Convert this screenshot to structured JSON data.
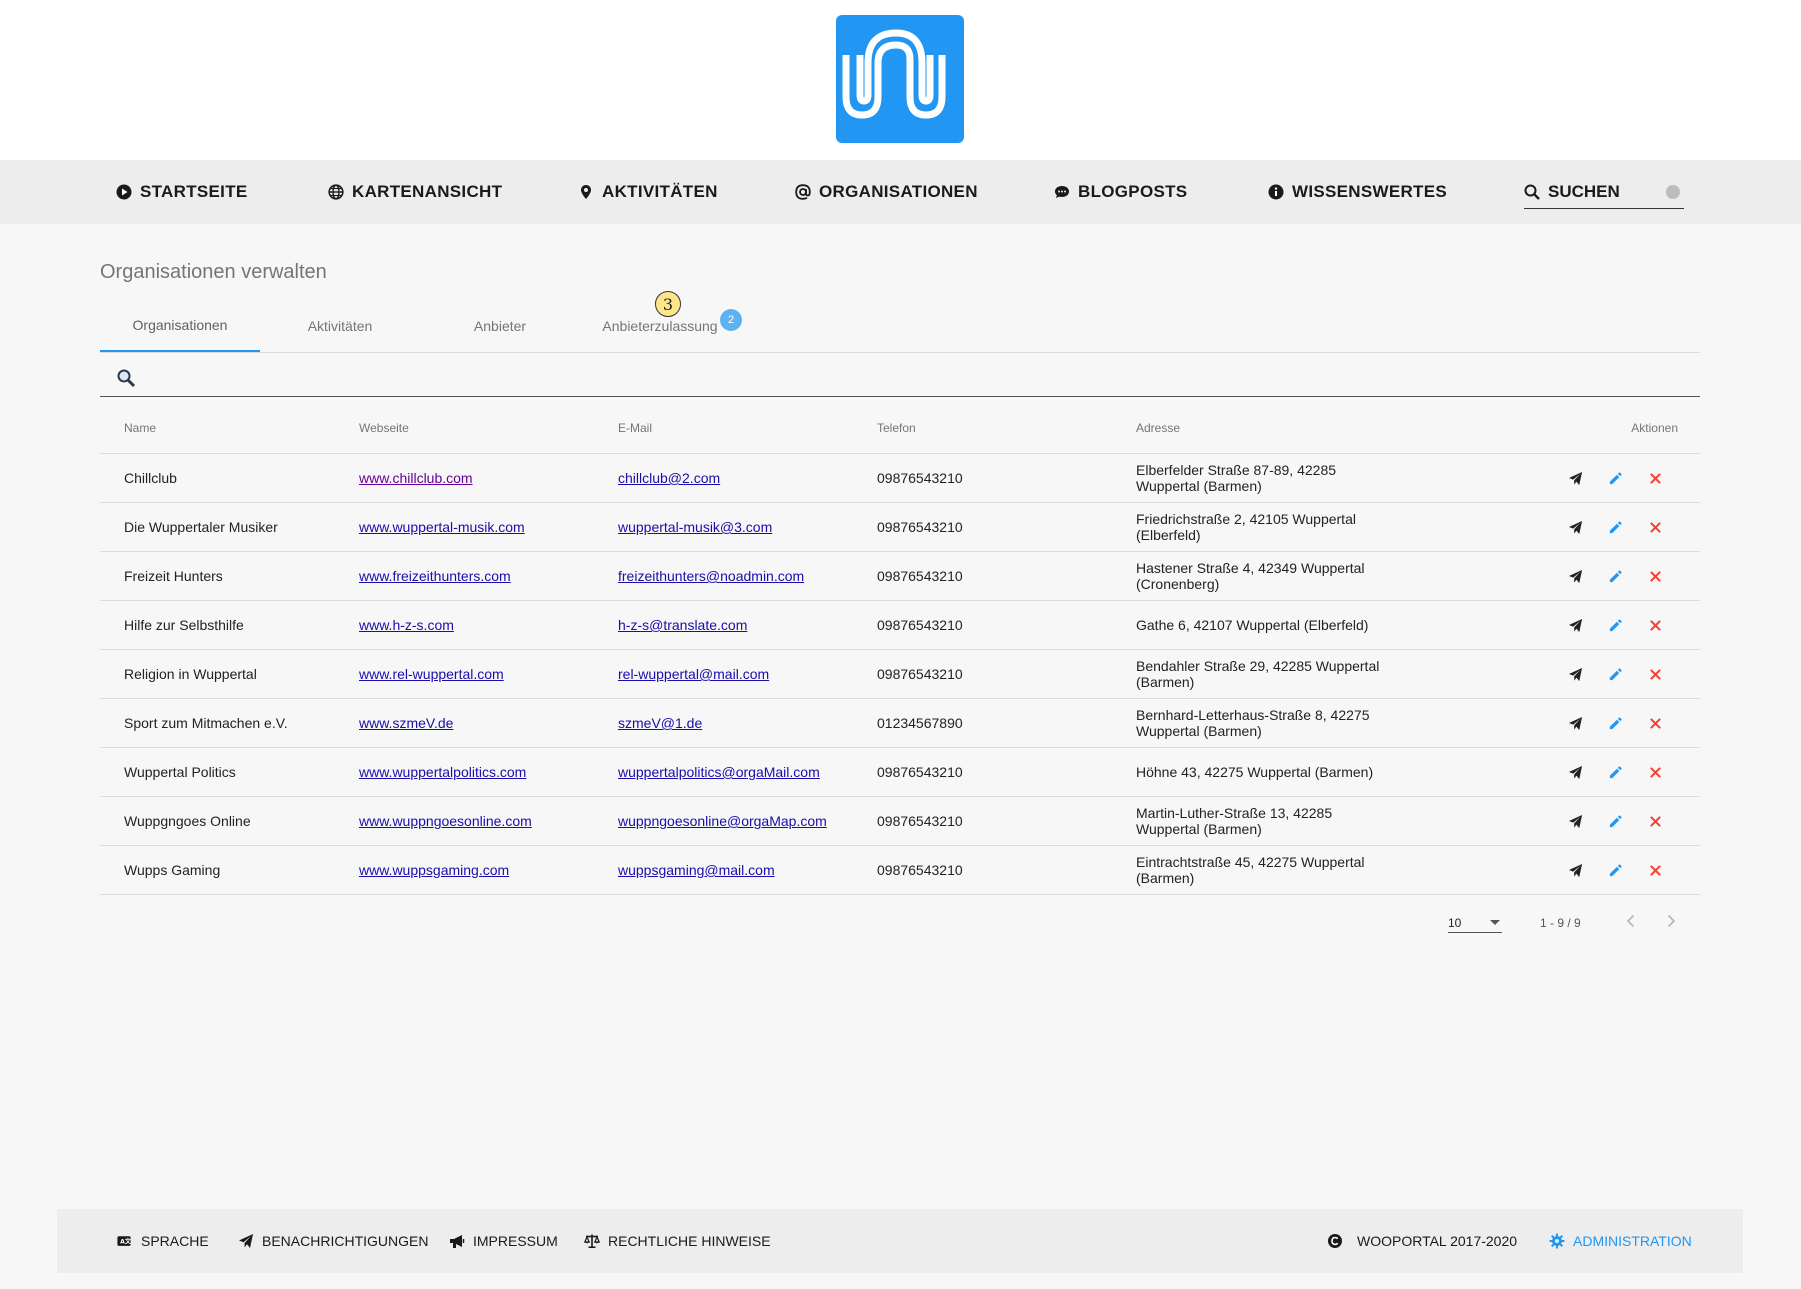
{
  "logo": {
    "icon": "wooportal-logo-icon",
    "color": "#2196f3"
  },
  "nav": {
    "items": [
      {
        "label": "STARTSEITE",
        "icon": "play-circle-icon"
      },
      {
        "label": "KARTENANSICHT",
        "icon": "globe-icon"
      },
      {
        "label": "AKTIVITÄTEN",
        "icon": "map-marker-icon"
      },
      {
        "label": "ORGANISATIONEN",
        "icon": "at-icon"
      },
      {
        "label": "BLOGPOSTS",
        "icon": "comment-dots-icon"
      },
      {
        "label": "WISSENSWERTES",
        "icon": "info-circle-icon"
      }
    ],
    "search_label": "SUCHEN"
  },
  "page": {
    "title": "Organisationen verwalten"
  },
  "tabs": [
    {
      "label": "Organisationen",
      "active": true
    },
    {
      "label": "Aktivitäten"
    },
    {
      "label": "Anbieter"
    },
    {
      "label": "Anbieterzulassung",
      "badge": "2"
    }
  ],
  "step_marker": "3",
  "search": {
    "placeholder": ""
  },
  "table": {
    "columns": [
      "Name",
      "Webseite",
      "E-Mail",
      "Telefon",
      "Adresse",
      "Aktionen"
    ],
    "rows": [
      {
        "name": "Chillclub",
        "website": "www.chillclub.com",
        "email": "chillclub@2.com",
        "phone": "09876543210",
        "address": [
          "Elberfelder Straße 87-89, 42285",
          "Wuppertal (Barmen)"
        ]
      },
      {
        "name": "Die Wuppertaler Musiker",
        "website": "www.wuppertal-musik.com",
        "email": "wuppertal-musik@3.com",
        "phone": "09876543210",
        "address": [
          "Friedrichstraße 2, 42105 Wuppertal",
          "(Elberfeld)"
        ]
      },
      {
        "name": "Freizeit Hunters",
        "website": "www.freizeithunters.com",
        "email": "freizeithunters@noadmin.com",
        "phone": "09876543210",
        "address": [
          "Hastener Straße 4, 42349 Wuppertal",
          "(Cronenberg)"
        ]
      },
      {
        "name": "Hilfe zur Selbsthilfe",
        "website": "www.h-z-s.com",
        "email": "h-z-s@translate.com",
        "phone": "09876543210",
        "address": [
          "Gathe 6, 42107 Wuppertal (Elberfeld)",
          ""
        ]
      },
      {
        "name": "Religion in Wuppertal",
        "website": "www.rel-wuppertal.com",
        "email": "rel-wuppertal@mail.com",
        "phone": "09876543210",
        "address": [
          "Bendahler Straße 29, 42285 Wuppertal",
          "(Barmen)"
        ]
      },
      {
        "name": "Sport zum Mitmachen e.V.",
        "website": "www.szmeV.de",
        "email": "szmeV@1.de",
        "phone": "01234567890",
        "address": [
          "Bernhard-Letterhaus-Straße 8, 42275",
          "Wuppertal (Barmen)"
        ]
      },
      {
        "name": "Wuppertal Politics",
        "website": "www.wuppertalpolitics.com",
        "email": "wuppertalpolitics@orgaMail.com",
        "phone": "09876543210",
        "address": [
          "Höhne 43, 42275 Wuppertal (Barmen)",
          ""
        ]
      },
      {
        "name": "Wuppgngoes Online",
        "website": "www.wuppngoesonline.com",
        "email": "wuppngoesonline@orgaMap.com",
        "phone": "09876543210",
        "address": [
          "Martin-Luther-Straße 13, 42285",
          "Wuppertal (Barmen)"
        ]
      },
      {
        "name": "Wupps Gaming",
        "website": "www.wuppsgaming.com",
        "email": "wuppsgaming@mail.com",
        "phone": "09876543210",
        "address": [
          "Eintrachtstraße 45, 42275 Wuppertal",
          "(Barmen)"
        ]
      }
    ],
    "row_actions": [
      "send-icon",
      "edit-pencil-icon",
      "delete-x-icon"
    ],
    "action_colors": {
      "send": "#222222",
      "edit": "#2196f3",
      "delete": "#f44336"
    }
  },
  "paginator": {
    "page_size": "10",
    "range": "1 - 9 / 9"
  },
  "footer": {
    "left": [
      {
        "label": "SPRACHE",
        "icon": "language-icon"
      },
      {
        "label": "BENACHRICHTIGUNGEN",
        "icon": "paper-plane-icon"
      },
      {
        "label": "IMPRESSUM",
        "icon": "megaphone-icon"
      },
      {
        "label": "RECHTLICHE HINWEISE",
        "icon": "balance-scale-icon"
      }
    ],
    "copyright": "WOOPORTAL 2017-2020",
    "admin": "ADMINISTRATION"
  }
}
